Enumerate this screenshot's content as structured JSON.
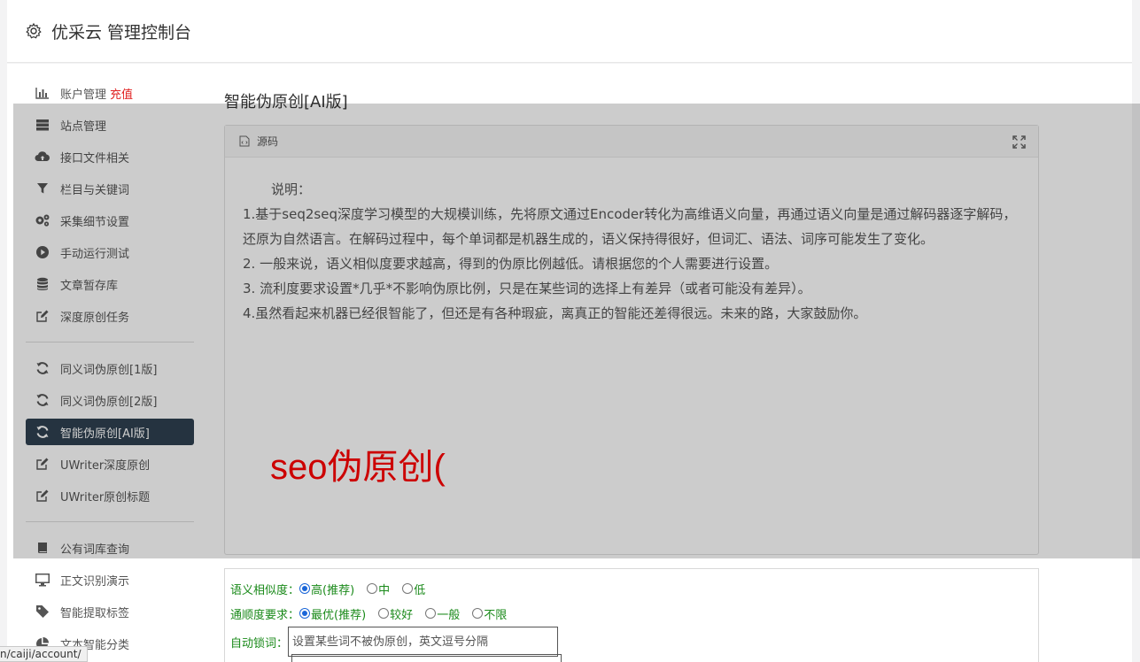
{
  "header": {
    "title": "优采云 管理控制台",
    "icon": "gear-icon"
  },
  "sidebar": {
    "group1": [
      {
        "label": "账户管理",
        "extra": "充值",
        "icon": "bar-chart-icon"
      },
      {
        "label": "站点管理",
        "icon": "server-icon"
      },
      {
        "label": "接口文件相关",
        "icon": "cloud-upload-icon"
      },
      {
        "label": "栏目与关键词",
        "icon": "filter-icon"
      },
      {
        "label": "采集细节设置",
        "icon": "cogs-icon"
      },
      {
        "label": "手动运行测试",
        "icon": "play-icon"
      },
      {
        "label": "文章暂存库",
        "icon": "database-icon"
      },
      {
        "label": "深度原创任务",
        "icon": "edit-icon"
      }
    ],
    "group2": [
      {
        "label": "同义词伪原创[1版]",
        "icon": "refresh-icon"
      },
      {
        "label": "同义词伪原创[2版]",
        "icon": "refresh-icon"
      },
      {
        "label": "智能伪原创[AI版]",
        "icon": "refresh-icon",
        "active": true
      },
      {
        "label": "UWriter深度原创",
        "icon": "edit-icon"
      },
      {
        "label": "UWriter原创标题",
        "icon": "edit-icon"
      }
    ],
    "group3": [
      {
        "label": "公有词库查询",
        "icon": "book-icon"
      },
      {
        "label": "正文识别演示",
        "icon": "monitor-icon"
      },
      {
        "label": "智能提取标签",
        "icon": "tag-icon"
      },
      {
        "label": "文本智能分类",
        "icon": "pie-chart-icon"
      }
    ]
  },
  "main": {
    "page_title": "智能伪原创[AI版]",
    "source_label": "源码",
    "description": {
      "lead": "说明：",
      "lines": [
        "1.基于seq2seq深度学习模型的大规模训练，先将原文通过Encoder转化为高维语义向量，再通过语义向量是通过解码器逐字解码，还原为自然语言。在解码过程中，每个单词都是机器生成的，语义保持得很好，但词汇、语法、词序可能发生了变化。",
        "2. 一般来说，语义相似度要求越高，得到的伪原比例越低。请根据您的个人需要进行设置。",
        "3. 流利度要求设置*几乎*不影响伪原比例，只是在某些词的选择上有差异（或者可能没有差异）。",
        "4.虽然看起来机器已经很智能了，但还是有各种瑕疵，离真正的智能还差得很远。未来的路，大家鼓励你。"
      ]
    },
    "input_text": "seo伪原创(",
    "options": {
      "similarity": {
        "label": "语义相似度：",
        "choices": [
          "高(推荐)",
          "中",
          "低"
        ],
        "selected": 0
      },
      "fluency": {
        "label": "通顺度要求：",
        "choices": [
          "最优(推荐)",
          "较好",
          "一般",
          "不限"
        ],
        "selected": 0
      },
      "lock": {
        "label": "自动锁词：",
        "placeholder": "设置某些词不被伪原创，英文逗号分隔"
      }
    }
  },
  "statusbar": {
    "url": "n/caiji/account/"
  },
  "colors": {
    "accent": "#2f4050",
    "red": "#ff0000",
    "green": "#1a8a1a"
  }
}
